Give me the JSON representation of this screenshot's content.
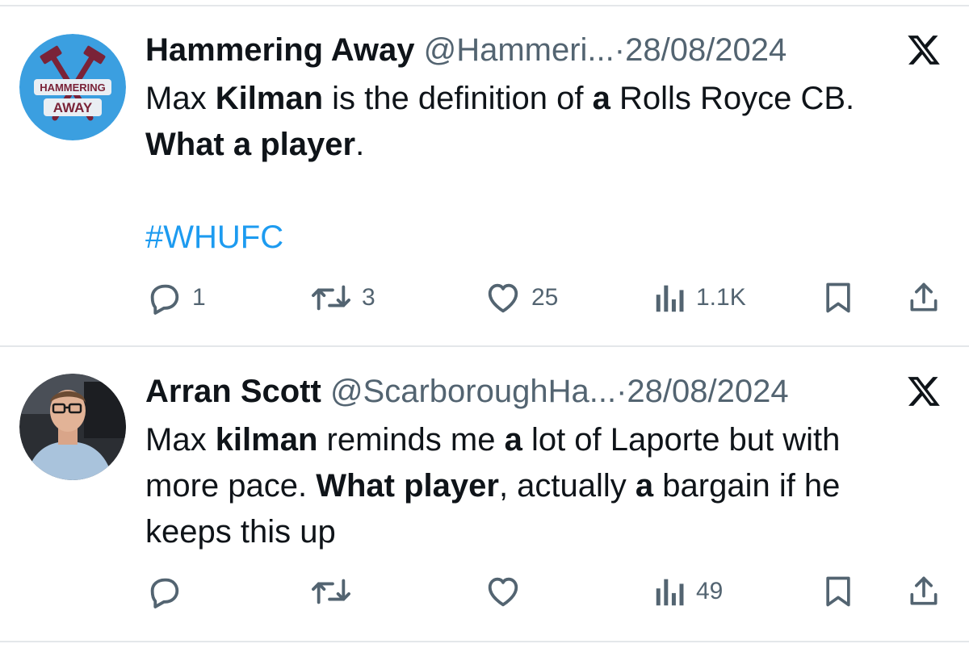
{
  "tweets": [
    {
      "display_name": "Hammering Away",
      "handle": "@Hammeri...",
      "separator": "·",
      "date": "28/08/2024",
      "avatar_text_top": "HAMMERING",
      "avatar_text_bottom": "AWAY",
      "text": {
        "p1": "Max ",
        "b1": "Kilman",
        "p2": " is the definition of ",
        "b2": "a",
        "p3": " Rolls Royce CB.",
        "b3": "What a player",
        "p4": "."
      },
      "hashtag": "#WHUFC",
      "stats": {
        "replies": "1",
        "retweets": "3",
        "likes": "25",
        "views": "1.1K"
      }
    },
    {
      "display_name": "Arran Scott",
      "handle": "@ScarboroughHa...",
      "separator": "·",
      "date": "28/08/2024",
      "text": {
        "p1": "Max ",
        "b1": "kilman",
        "p2": " reminds me ",
        "b2": "a",
        "p3": " lot of Laporte but with",
        "p4": "more pace. ",
        "b3": "What player",
        "p5": ", actually ",
        "b4": "a",
        "p6": " bargain if he",
        "p7": "keeps this up"
      },
      "stats": {
        "views": "49"
      }
    }
  ],
  "colors": {
    "text": "#0f1419",
    "secondary": "#536471",
    "link": "#1d9bf0",
    "divider": "#e4e7ea",
    "avatar_blue": "#3b9fe0"
  },
  "icons": [
    "reply-icon",
    "retweet-icon",
    "like-icon",
    "views-icon",
    "bookmark-icon",
    "share-icon",
    "x-logo-icon"
  ]
}
